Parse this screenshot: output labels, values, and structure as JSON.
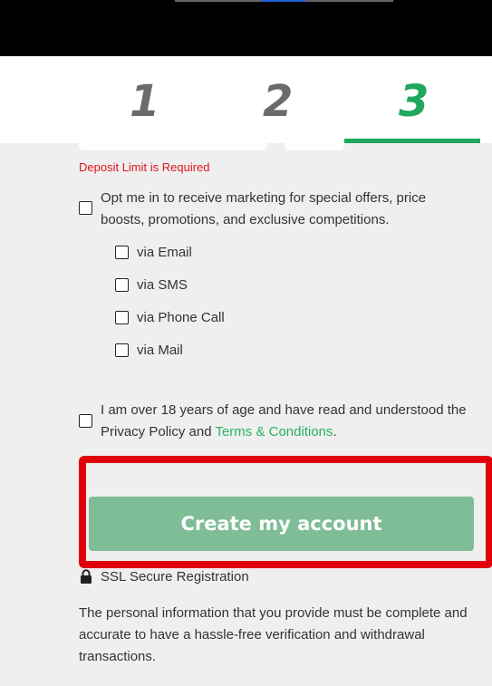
{
  "steps": [
    {
      "label": "1",
      "active": false
    },
    {
      "label": "2",
      "active": false
    },
    {
      "label": "3",
      "active": true
    }
  ],
  "form": {
    "error_message": "Deposit Limit is Required",
    "marketing_optin": {
      "label": "Opt me in to receive marketing for special offers, price boosts, promotions, and exclusive competitions.",
      "checked": false,
      "channels": [
        {
          "label": "via Email",
          "checked": false
        },
        {
          "label": "via SMS",
          "checked": false
        },
        {
          "label": "via Phone Call",
          "checked": false
        },
        {
          "label": "via Mail",
          "checked": false
        }
      ]
    },
    "age_terms": {
      "text_before": "I am over 18 years of age and have read and understood the Privacy Policy and ",
      "link_text": "Terms & Conditions",
      "text_after": ".",
      "checked": false
    },
    "submit_label": "Create my account",
    "ssl_label": "SSL Secure Registration",
    "info_text": "The personal information that you provide must be complete and accurate to have a hassle-free verification and withdrawal transactions."
  },
  "colors": {
    "accent_green": "#1fa75c",
    "link_green": "#28b463",
    "button_green": "#7fbd97",
    "error_red": "#e0141e",
    "highlight_red": "#e0000b"
  }
}
